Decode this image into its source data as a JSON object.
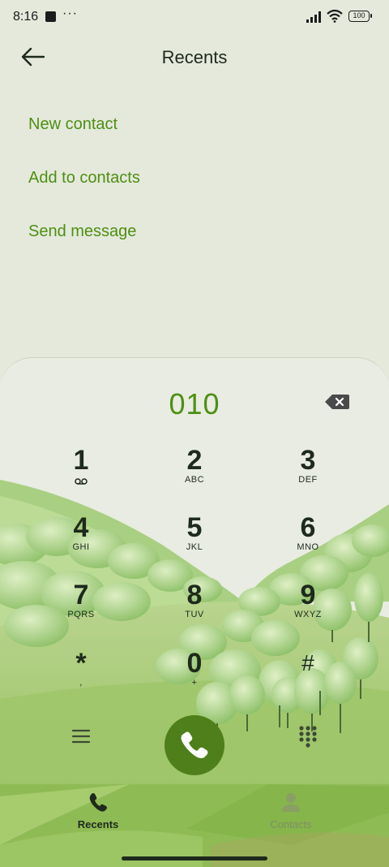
{
  "status_bar": {
    "time": "8:16",
    "dots": "···",
    "battery": "100"
  },
  "header": {
    "title": "Recents"
  },
  "actions": [
    "New contact",
    "Add to contacts",
    "Send message"
  ],
  "dialer": {
    "number": "010",
    "keys": [
      {
        "digit": "1",
        "letters": "∞"
      },
      {
        "digit": "2",
        "letters": "ABC"
      },
      {
        "digit": "3",
        "letters": "DEF"
      },
      {
        "digit": "4",
        "letters": "GHI"
      },
      {
        "digit": "5",
        "letters": "JKL"
      },
      {
        "digit": "6",
        "letters": "MNO"
      },
      {
        "digit": "7",
        "letters": "PQRS"
      },
      {
        "digit": "8",
        "letters": "TUV"
      },
      {
        "digit": "9",
        "letters": "WXYZ"
      },
      {
        "digit": "*",
        "letters": ","
      },
      {
        "digit": "0",
        "letters": "+"
      },
      {
        "digit": "#",
        "letters": ""
      }
    ]
  },
  "bottom_nav": {
    "recents": "Recents",
    "contacts": "Contacts"
  },
  "colors": {
    "accent": "#4e8f12",
    "call_button": "#4e7f1a",
    "text_dark": "#1e2a1c"
  }
}
